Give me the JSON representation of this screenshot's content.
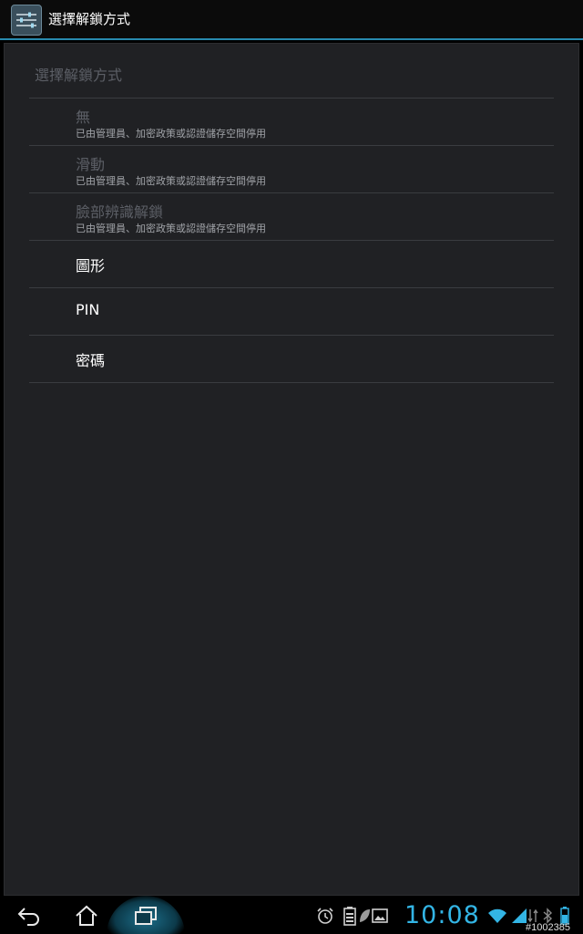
{
  "action_bar": {
    "title": "選擇解鎖方式",
    "app_icon": "settings-sliders-icon"
  },
  "list": {
    "category": "選擇解鎖方式",
    "items": [
      {
        "title": "無",
        "summary": "已由管理員、加密政策或認證儲存空間停用",
        "enabled": false
      },
      {
        "title": "滑動",
        "summary": "已由管理員、加密政策或認證儲存空間停用",
        "enabled": false
      },
      {
        "title": "臉部辨識解鎖",
        "summary": "已由管理員、加密政策或認證儲存空間停用",
        "enabled": false
      },
      {
        "title": "圖形",
        "enabled": true
      },
      {
        "title": "PIN",
        "enabled": true
      },
      {
        "title": "密碼",
        "enabled": true
      }
    ]
  },
  "nav_bar": {
    "buttons": [
      "back-icon",
      "home-icon",
      "recent-apps-icon"
    ]
  },
  "status_bar": {
    "clock": "10:08",
    "icons": [
      "alarm-icon",
      "battery-icon",
      "leaf-icon",
      "gallery-icon",
      "wifi-icon",
      "signal-icon",
      "data-arrows-icon",
      "bluetooth-icon",
      "battery-level-icon"
    ]
  },
  "watermark": "#1002385",
  "colors": {
    "accent": "#33b5e5",
    "panel": "#202124",
    "disabled_text": "#5c5f66",
    "summary_text": "#a0a3a8"
  }
}
